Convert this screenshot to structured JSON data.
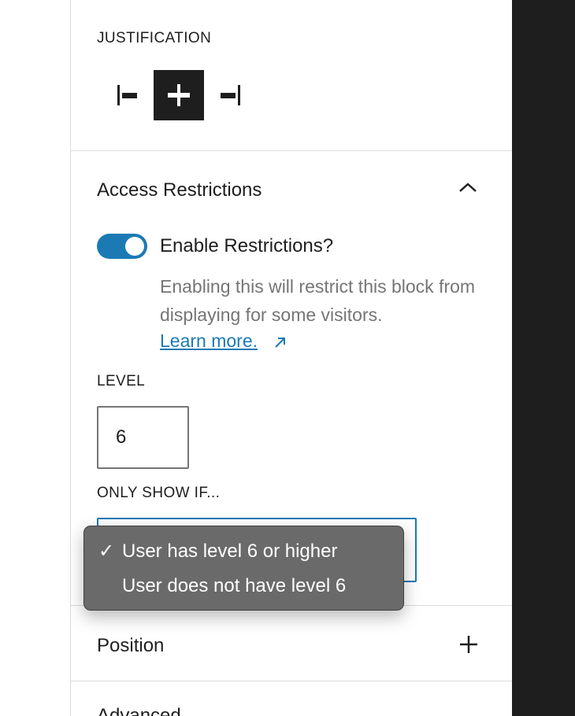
{
  "justification": {
    "label": "JUSTIFICATION",
    "options": [
      "justify-left",
      "justify-center",
      "justify-right"
    ],
    "selected": "justify-center"
  },
  "access_restrictions": {
    "title": "Access Restrictions",
    "expanded": true,
    "toggle": {
      "label": "Enable Restrictions?",
      "enabled": true
    },
    "help_text": "Enabling this will restrict this block from displaying for some visitors.",
    "learn_more": "Learn more.",
    "level": {
      "label": "LEVEL",
      "value": "6"
    },
    "only_show_if": {
      "label": "ONLY SHOW IF...",
      "selected": "User has level 6 or higher",
      "options": [
        {
          "label": "User has level 6 or higher",
          "checked": true
        },
        {
          "label": "User does not have level 6",
          "checked": false
        }
      ]
    }
  },
  "position": {
    "title": "Position"
  },
  "advanced": {
    "title": "Advanced"
  },
  "colors": {
    "accent": "#1b7ab4",
    "dark_pane": "#1e1e1e",
    "menu_bg": "#6a6a6a",
    "muted_text": "#757575"
  }
}
